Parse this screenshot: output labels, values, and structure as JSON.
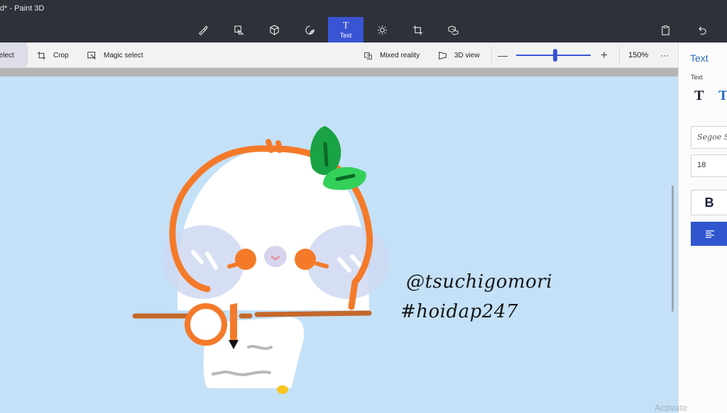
{
  "window": {
    "title": "d* - Paint 3D"
  },
  "tools": [
    {
      "name": "brushes",
      "icon": "brush-icon"
    },
    {
      "name": "2d-shapes",
      "icon": "2d-shapes-icon"
    },
    {
      "name": "3d-shapes",
      "icon": "cube-icon"
    },
    {
      "name": "stickers",
      "icon": "sticker-icon"
    },
    {
      "name": "text",
      "icon": "text-icon",
      "label": "Text",
      "active": true
    },
    {
      "name": "effects",
      "icon": "sun-icon"
    },
    {
      "name": "canvas",
      "icon": "canvas-crop-icon"
    },
    {
      "name": "3d-library",
      "icon": "library-cube-icon"
    }
  ],
  "toolbar_right": {
    "paste_icon": "paste-icon",
    "undo_icon": "undo-icon"
  },
  "subbar": {
    "select_label": "Select",
    "crop_label": "Crop",
    "magic_select_label": "Magic select",
    "mixed_reality_label": "Mixed reality",
    "view3d_label": "3D view",
    "zoom_percent": "150%",
    "zoom_level": 0.5,
    "more_label": "···"
  },
  "canvas": {
    "text_line_1": "@tsuchigomori",
    "text_line_2": "#hoidap247"
  },
  "panel": {
    "title": "Text",
    "subtitle": "Text",
    "font_value": "Segoe Script",
    "size_value": "18",
    "bold_label": "B"
  },
  "watermark": "Activate Windows",
  "colors": {
    "accent": "#3a55d4",
    "canvas_bg": "#c4e1f8",
    "orange": "#f47a2a",
    "leaf": "#1aa344"
  }
}
